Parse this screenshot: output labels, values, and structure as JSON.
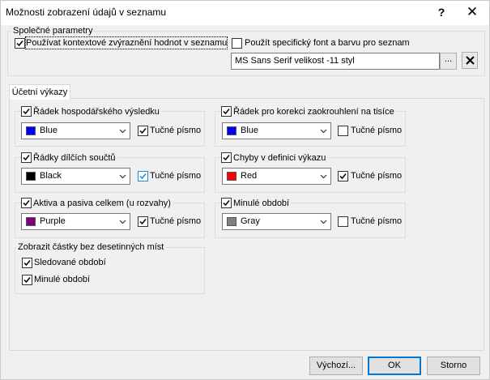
{
  "window": {
    "title": "Možnosti zobrazení údajů v seznamu",
    "help_glyph": "?",
    "close_glyph": "✕"
  },
  "common": {
    "legend": "Společné parametry",
    "context_highlight_label": "Používat kontextové zvýraznění hodnot v seznamu",
    "context_highlight_checked": true,
    "specific_font_label": "Použít specifický font a barvu pro seznam",
    "specific_font_checked": false,
    "font_value": "MS Sans Serif velikost -11 styl",
    "browse_label": "...",
    "clear_icon": "x-icon"
  },
  "tab": {
    "label": "Účetní výkazy"
  },
  "groups": [
    {
      "label": "Řádek hospodářského výsledku",
      "checked": true,
      "color_name": "Blue",
      "color": "#0000ff",
      "bold_label": "Tučné písmo",
      "bold_checked": true
    },
    {
      "label": "Řádek pro korekci zaokrouhlení na tisíce",
      "checked": true,
      "color_name": "Blue",
      "color": "#0000ff",
      "bold_label": "Tučné písmo",
      "bold_checked": false
    },
    {
      "label": "Řádky dílčích součtů",
      "checked": true,
      "color_name": "Black",
      "color": "#000000",
      "bold_label": "Tučné písmo",
      "bold_checked": true
    },
    {
      "label": "Chyby v definici výkazu",
      "checked": true,
      "color_name": "Red",
      "color": "#ff0000",
      "bold_label": "Tučné písmo",
      "bold_checked": true
    },
    {
      "label": "Aktiva a pasiva celkem (u rozvahy)",
      "checked": true,
      "color_name": "Purple",
      "color": "#800080",
      "bold_label": "Tučné písmo",
      "bold_checked": true
    },
    {
      "label": "Minulé období",
      "checked": true,
      "color_name": "Gray",
      "color": "#808080",
      "bold_label": "Tučné písmo",
      "bold_checked": false
    }
  ],
  "decimals": {
    "legend": "Zobrazit částky bez desetinných míst",
    "tracked_label": "Sledované období",
    "tracked_checked": true,
    "previous_label": "Minulé období",
    "previous_checked": true
  },
  "buttons": {
    "defaults_label": "Výchozí...",
    "ok_label": "OK",
    "cancel_label": "Storno"
  }
}
